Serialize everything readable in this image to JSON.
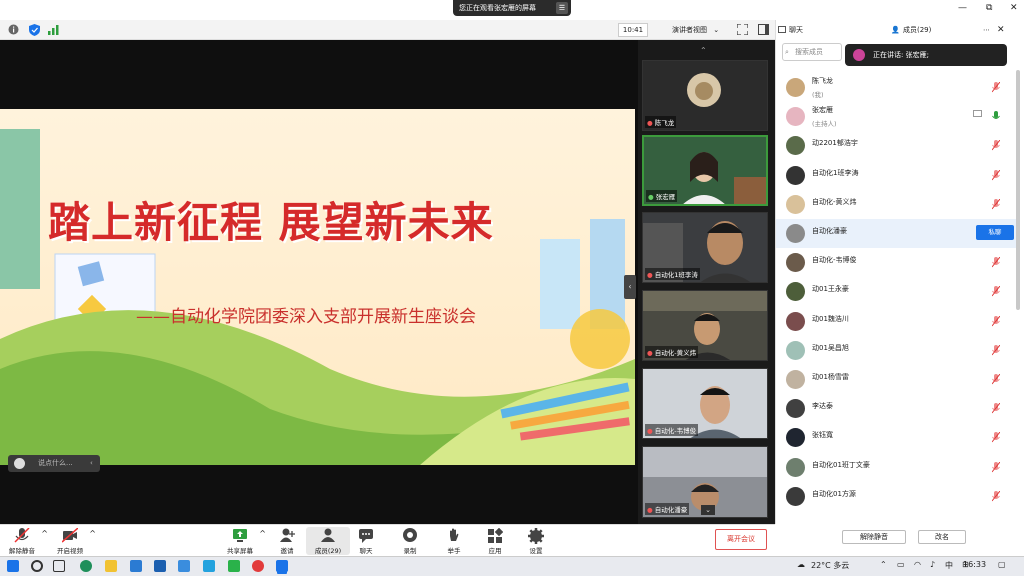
{
  "banner": {
    "text": "您正在观看张宏雁的屏幕",
    "option_icon": "menu-icon"
  },
  "window_controls": {
    "minimize": "—",
    "restore": "⧉",
    "close": "✕"
  },
  "toolbar": {
    "clock": "10:41",
    "view_mode": "演讲者视图"
  },
  "slide": {
    "title": "踏上新征程  展望新未来",
    "subtitle": "——自动化学院团委深入支部开展新生座谈会",
    "chat_placeholder": "说点什么..."
  },
  "videos": [
    {
      "name": "陈飞龙"
    },
    {
      "name": "张宏雁"
    },
    {
      "name": "自动化1班李涛"
    },
    {
      "name": "自动化-黄义炜"
    },
    {
      "name": "自动化-韦博俊"
    },
    {
      "name": "自动化潘豪"
    }
  ],
  "panel": {
    "tab_chat": "聊天",
    "tab_members": "成员(29)",
    "search_placeholder": "搜索成员",
    "speaking_label": "正在讲话: 张宏雁;",
    "dm_label": "私聊",
    "mute_all": "解除静音",
    "rename": "改名"
  },
  "members": [
    {
      "name": "陈飞龙",
      "role": "(我)",
      "color": "#c9a77a"
    },
    {
      "name": "张宏雁",
      "role": "(主持人)",
      "color": "#e6b5c0"
    },
    {
      "name": "动2201郁浩宇",
      "role": "",
      "color": "#5a6b4a"
    },
    {
      "name": "自动化1班李涛",
      "role": "",
      "color": "#333333"
    },
    {
      "name": "自动化-黄义炜",
      "role": "",
      "color": "#d9c19a"
    },
    {
      "name": "自动化潘豪",
      "role": "",
      "color": "#8a8a8a"
    },
    {
      "name": "自动化-韦博俊",
      "role": "",
      "color": "#6b5b4b"
    },
    {
      "name": "动01王永豪",
      "role": "",
      "color": "#4d5e3a"
    },
    {
      "name": "动01魏浩川",
      "role": "",
      "color": "#7a4d4d"
    },
    {
      "name": "动01吴昌旭",
      "role": "",
      "color": "#9fc0b6"
    },
    {
      "name": "动01杨雪雷",
      "role": "",
      "color": "#c0b2a0"
    },
    {
      "name": "李达泰",
      "role": "",
      "color": "#404040"
    },
    {
      "name": "张钰寬",
      "role": "",
      "color": "#1f2530"
    },
    {
      "name": "自动化01班丁文豪",
      "role": "",
      "color": "#6e7f6e"
    },
    {
      "name": "自动化01方源",
      "role": "",
      "color": "#3a3a3a"
    }
  ],
  "controls": [
    {
      "label": "解除静音",
      "icon": "mic-muted-icon"
    },
    {
      "label": "开启视频",
      "icon": "video-off-icon"
    },
    {
      "label": "共享屏幕",
      "icon": "share-screen-icon"
    },
    {
      "label": "邀请",
      "icon": "invite-icon"
    },
    {
      "label": "成员(29)",
      "icon": "members-icon"
    },
    {
      "label": "聊天",
      "icon": "chat-icon"
    },
    {
      "label": "录制",
      "icon": "record-icon"
    },
    {
      "label": "举手",
      "icon": "raise-hand-icon"
    },
    {
      "label": "应用",
      "icon": "apps-icon"
    },
    {
      "label": "设置",
      "icon": "settings-icon"
    }
  ],
  "leave_label": "离开会议",
  "taskbar": {
    "weather": "22°C 多云",
    "ime": "中",
    "time": "16:33"
  },
  "colors": {
    "accent": "#1a73e8",
    "danger": "#d9342b",
    "active_border": "#3c9b3c"
  }
}
